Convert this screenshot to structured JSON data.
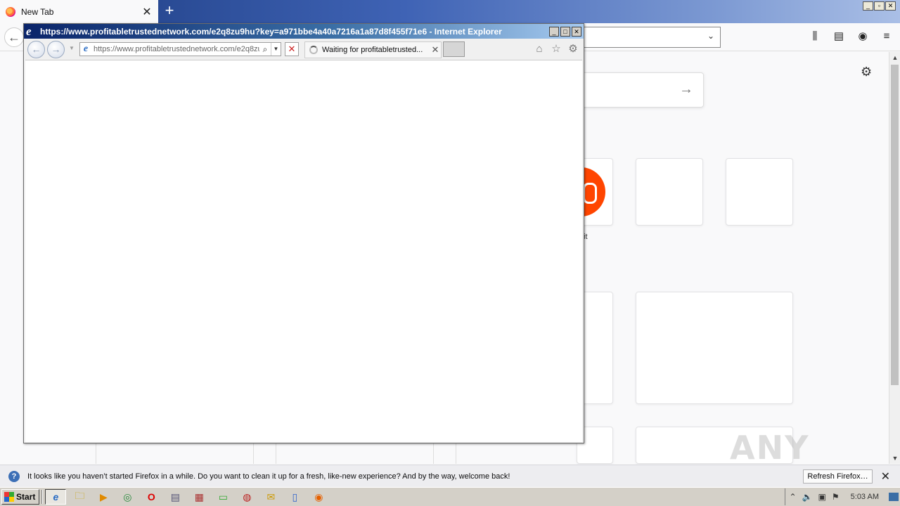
{
  "firefox": {
    "tab": {
      "title": "New Tab",
      "close": "✕"
    },
    "new_tab": "+",
    "window_controls": [
      "_",
      "▫",
      "✕"
    ],
    "back": "←",
    "url_dropdown": "⌄",
    "tools": {
      "library": "⫼",
      "sidebar": "▤",
      "account": "◉",
      "menu": "≡"
    },
    "settings_gear": "⚙",
    "search_arrow": "→",
    "tile_label": "it",
    "scroll_up": "▲",
    "scroll_down": "▼",
    "notification": {
      "icon": "?",
      "message": "It looks like you haven’t started Firefox in a while. Do you want to clean it up for a fresh, like-new experience? And by the way, welcome back!",
      "button": "Refresh Firefox…",
      "close": "✕"
    },
    "watermark": "ANY RUN"
  },
  "ie": {
    "logo": "e",
    "title": "https://www.profitabletrustednetwork.com/e2q8zu9hu?key=a971bbe4a40a7216a1a87d8f455f71e6 - Internet Explorer",
    "controls": [
      "_",
      "□",
      "✕"
    ],
    "back": "←",
    "forward": "→",
    "history_drop": "▼",
    "address": "https://www.profitabletrustednetwork.com/e2q8zu9hu?key=a971bbe4a40a7216a1a87d8f455f71e6",
    "search_icon": "⌕",
    "address_drop": "▼",
    "stop": "✕",
    "tab_label": "Waiting for profitabletrusted...",
    "tab_close": "✕",
    "home": "⌂",
    "favorites": "☆",
    "tools": "⚙"
  },
  "taskbar": {
    "start": "Start",
    "apps": [
      "e",
      "🗀",
      "▶",
      "◎",
      "O",
      "▤",
      "▦",
      "▭",
      "◍",
      "✉",
      "▯",
      "◉"
    ],
    "tray_icons": [
      "⌃",
      "🔈",
      "▣",
      "⚑"
    ],
    "clock": "5:03 AM"
  }
}
